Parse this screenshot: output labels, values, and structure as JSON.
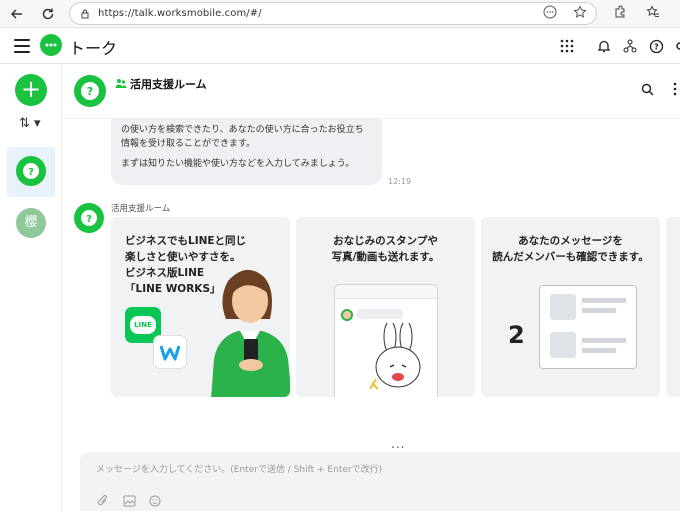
{
  "browser": {
    "url": "https://talk.worksmobile.com/#/",
    "icons": [
      "back-arrow-icon",
      "reload-icon",
      "info-icon",
      "more-circle-icon",
      "star-icon",
      "extensions-icon",
      "favorites-icon"
    ]
  },
  "header": {
    "title": "トーク",
    "icons": [
      "apps-grid-icon",
      "bell-icon",
      "org-chart-icon",
      "help-icon",
      "settings-icon"
    ]
  },
  "rail": {
    "new_label": "+",
    "sort_label": "⇅ ▾",
    "second_avatar_text": "櫻"
  },
  "chat": {
    "title": "活用支援ルーム",
    "bubble_lines": [
      "の使い方を検索できたり、あなたの使い方に合ったお役立ち",
      "情報を受け取ることができます。",
      "",
      "まずは知りたい機能や使い方などを入力してみましょう。"
    ],
    "time": "12:19",
    "sender": "活用支援ルーム",
    "cards": [
      {
        "lines": [
          "ビジネスでもLINEと同じ",
          "楽しさと使いやすさを。",
          "ビジネス版LINE",
          "「LINE WORKS」"
        ]
      },
      {
        "lines": [
          "おなじみのスタンプや",
          "写真/動画も送れます。"
        ]
      },
      {
        "lines": [
          "あなたのメッセージを",
          "読んだメンバーも確認できます。"
        ]
      }
    ],
    "card1_logo_text": "LINE",
    "card3_count": "2",
    "more": "..."
  },
  "input": {
    "placeholder": "メッセージを入力してください。(Enterで送信 / Shift + Enterで改行)"
  },
  "colors": {
    "brand_green": "#19c33f",
    "selected_bg": "#e8f3f9",
    "card_bg": "#f1f2f4"
  }
}
